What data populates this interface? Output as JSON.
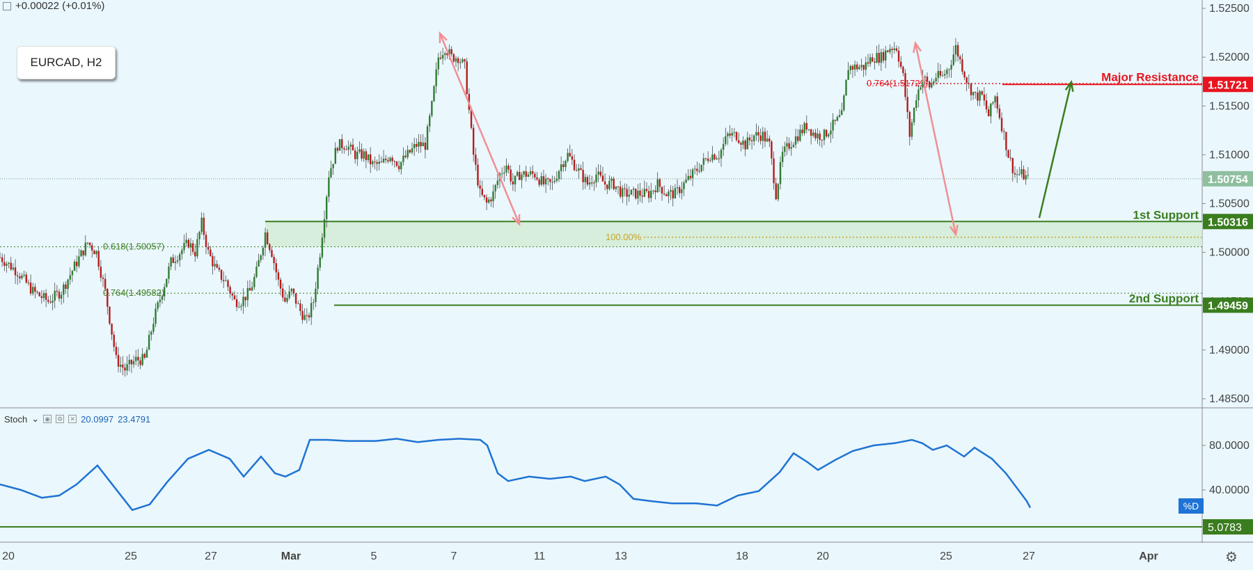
{
  "header": {
    "change": "+0.00022 (+0.01%)"
  },
  "symbol": "EURCAD, H2",
  "stoch": {
    "label": "Stoch",
    "v1": "20.0997",
    "v2": "23.4791",
    "tag": "%D"
  },
  "price_axis": {
    "ticks": [
      "1.52500",
      "1.52000",
      "1.51500",
      "1.51000",
      "1.50500",
      "1.50000",
      "1.49500",
      "1.49000",
      "1.48500"
    ],
    "tick_values": [
      1.525,
      1.52,
      1.515,
      1.51,
      1.505,
      1.5,
      1.495,
      1.49,
      1.485
    ]
  },
  "stoch_axis": {
    "ticks": [
      "80.0000",
      "40.0000"
    ],
    "tick_values": [
      80,
      40
    ],
    "tag_value": "5.0783"
  },
  "time_axis": {
    "ticks": [
      "20",
      "25",
      "27",
      "Mar",
      "5",
      "7",
      "11",
      "13",
      "18",
      "20",
      "25",
      "27",
      "Apr"
    ]
  },
  "levels": {
    "major_resistance": {
      "label": "Major Resistance",
      "value": "1.51721",
      "color": "#e8141f"
    },
    "first_support": {
      "label": "1st Support",
      "value": "1.50316",
      "color": "#3a7d1f"
    },
    "second_support": {
      "label": "2nd Support",
      "value": "1.49459",
      "color": "#3a7d1f"
    },
    "current": {
      "value": "1.50754",
      "color": "#8fbf9f"
    }
  },
  "fib_labels": {
    "f618": "0.618(1.50057)",
    "f764a": "0.764(1.49582)",
    "f764b": "0.764(1.51729)",
    "f100": "100.00%"
  },
  "chart_data": {
    "type": "candlestick",
    "title": "EURCAD, H2",
    "ylim": [
      1.4835,
      1.5265
    ],
    "close_path": [
      [
        0,
        1.4995
      ],
      [
        8,
        1.498
      ],
      [
        15,
        1.496
      ],
      [
        22,
        1.495
      ],
      [
        28,
        1.496
      ],
      [
        35,
        1.499
      ],
      [
        40,
        1.501
      ],
      [
        44,
        1.5
      ],
      [
        48,
        1.496
      ],
      [
        53,
        1.489
      ],
      [
        57,
        1.488
      ],
      [
        62,
        1.489
      ],
      [
        66,
        1.489
      ],
      [
        70,
        1.493
      ],
      [
        74,
        1.496
      ],
      [
        78,
        1.499
      ],
      [
        82,
        1.5
      ],
      [
        86,
        1.501
      ],
      [
        89,
        1.5
      ],
      [
        92,
        1.503
      ],
      [
        95,
        1.5
      ],
      [
        99,
        1.498
      ],
      [
        103,
        1.497
      ],
      [
        107,
        1.495
      ],
      [
        110,
        1.495
      ],
      [
        114,
        1.496
      ],
      [
        117,
        1.498
      ],
      [
        121,
        1.502
      ],
      [
        124,
        1.5
      ],
      [
        127,
        1.497
      ],
      [
        130,
        1.495
      ],
      [
        133,
        1.496
      ],
      [
        137,
        1.494
      ],
      [
        140,
        1.493
      ],
      [
        143,
        1.495
      ],
      [
        146,
        1.5
      ],
      [
        150,
        1.508
      ],
      [
        154,
        1.511
      ],
      [
        158,
        1.511
      ],
      [
        162,
        1.51
      ],
      [
        166,
        1.51
      ],
      [
        170,
        1.509
      ],
      [
        174,
        1.509
      ],
      [
        178,
        1.51
      ],
      [
        182,
        1.509
      ],
      [
        186,
        1.51
      ],
      [
        190,
        1.511
      ],
      [
        194,
        1.511
      ],
      [
        197,
        1.515
      ],
      [
        200,
        1.52
      ],
      [
        203,
        1.521
      ],
      [
        206,
        1.52
      ],
      [
        209,
        1.52
      ],
      [
        212,
        1.519
      ],
      [
        216,
        1.51
      ],
      [
        219,
        1.506
      ],
      [
        222,
        1.505
      ],
      [
        225,
        1.506
      ],
      [
        228,
        1.508
      ],
      [
        231,
        1.509
      ],
      [
        234,
        1.507
      ],
      [
        237,
        1.508
      ],
      [
        240,
        1.508
      ],
      [
        244,
        1.508
      ],
      [
        248,
        1.507
      ],
      [
        252,
        1.507
      ],
      [
        256,
        1.509
      ],
      [
        259,
        1.51
      ],
      [
        262,
        1.509
      ],
      [
        265,
        1.508
      ],
      [
        268,
        1.507
      ],
      [
        272,
        1.508
      ],
      [
        276,
        1.507
      ],
      [
        280,
        1.507
      ],
      [
        284,
        1.506
      ],
      [
        288,
        1.506
      ],
      [
        292,
        1.506
      ],
      [
        296,
        1.506
      ],
      [
        300,
        1.507
      ],
      [
        304,
        1.506
      ],
      [
        308,
        1.506
      ],
      [
        312,
        1.507
      ],
      [
        316,
        1.508
      ],
      [
        320,
        1.509
      ],
      [
        324,
        1.51
      ],
      [
        328,
        1.51
      ],
      [
        332,
        1.512
      ],
      [
        336,
        1.512
      ],
      [
        340,
        1.511
      ],
      [
        344,
        1.512
      ],
      [
        348,
        1.512
      ],
      [
        351,
        1.511
      ],
      [
        354,
        1.506
      ],
      [
        357,
        1.51
      ],
      [
        360,
        1.511
      ],
      [
        364,
        1.512
      ],
      [
        368,
        1.513
      ],
      [
        372,
        1.512
      ],
      [
        376,
        1.512
      ],
      [
        380,
        1.513
      ],
      [
        384,
        1.514
      ],
      [
        387,
        1.519
      ],
      [
        390,
        1.519
      ],
      [
        394,
        1.519
      ],
      [
        398,
        1.52
      ],
      [
        402,
        1.52
      ],
      [
        406,
        1.521
      ],
      [
        409,
        1.521
      ],
      [
        412,
        1.518
      ],
      [
        415,
        1.512
      ],
      [
        418,
        1.516
      ],
      [
        421,
        1.518
      ],
      [
        424,
        1.517
      ],
      [
        427,
        1.518
      ],
      [
        430,
        1.518
      ],
      [
        433,
        1.519
      ],
      [
        436,
        1.521
      ],
      [
        439,
        1.519
      ],
      [
        442,
        1.517
      ],
      [
        445,
        1.516
      ],
      [
        448,
        1.516
      ],
      [
        451,
        1.514
      ],
      [
        454,
        1.516
      ],
      [
        457,
        1.513
      ],
      [
        460,
        1.51
      ],
      [
        463,
        1.508
      ],
      [
        466,
        1.508
      ],
      [
        469,
        1.5075
      ]
    ]
  }
}
